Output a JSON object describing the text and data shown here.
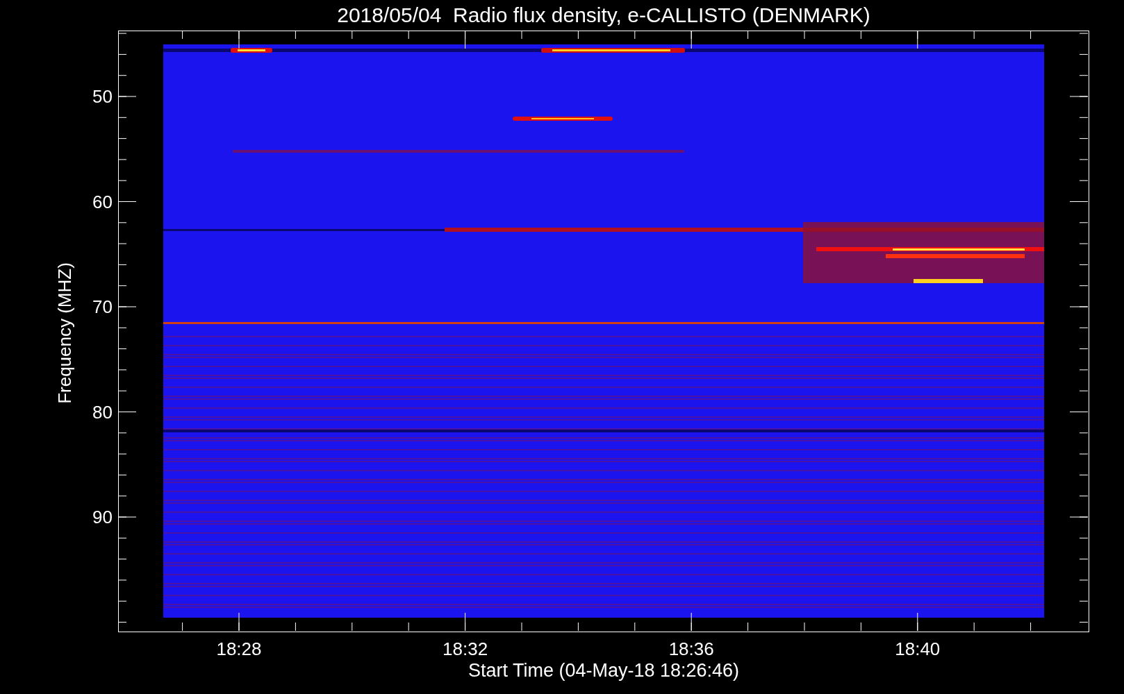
{
  "title": "2018/05/04  Radio flux density, e-CALLISTO (DENMARK)",
  "y_axis": {
    "label": "Frequency (MHZ)",
    "ticks": [
      "50",
      "60",
      "70",
      "80",
      "90"
    ]
  },
  "x_axis": {
    "label": "Start Time (04-May-18 18:26:46)",
    "ticks": [
      "18:28",
      "18:32",
      "18:36",
      "18:40"
    ]
  }
}
